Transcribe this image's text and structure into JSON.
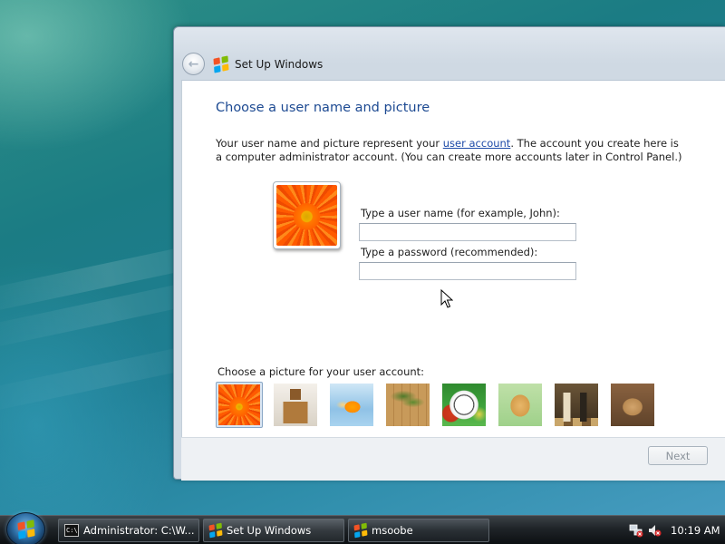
{
  "window": {
    "title": "Set Up Windows"
  },
  "page": {
    "heading": "Choose a user name and picture",
    "description_before_link": "Your user name and picture represent your ",
    "description_link": "user account",
    "description_after_link": ". The account you create here is a computer administrator account. (You can create more accounts later in Control Panel.)",
    "username_label": "Type a user name (for example, John):",
    "username_value": "",
    "password_label": "Type a password (recommended):",
    "password_value": "",
    "picture_label": "Choose a picture for your user account:",
    "pictures": [
      {
        "name": "flower",
        "selected": true
      },
      {
        "name": "robot",
        "selected": false
      },
      {
        "name": "goldfish",
        "selected": false
      },
      {
        "name": "bonsai",
        "selected": false
      },
      {
        "name": "soccer-ball",
        "selected": false
      },
      {
        "name": "dog",
        "selected": false
      },
      {
        "name": "chess",
        "selected": false
      },
      {
        "name": "kitten",
        "selected": false
      }
    ]
  },
  "footer": {
    "next_label": "Next",
    "next_enabled": false
  },
  "taskbar": {
    "tasks": [
      {
        "label": "Administrator: C:\\W...",
        "icon": "cmd-icon"
      },
      {
        "label": "Set Up Windows",
        "icon": "windows-icon"
      },
      {
        "label": "msoobe",
        "icon": "windows-icon"
      }
    ],
    "clock": "10:19 AM",
    "tray_icons": [
      "network-disconnected-icon",
      "volume-muted-icon"
    ]
  },
  "colors": {
    "heading": "#1d4a92",
    "link": "#1d4aa8",
    "accent_start": "#2f6fa6"
  }
}
